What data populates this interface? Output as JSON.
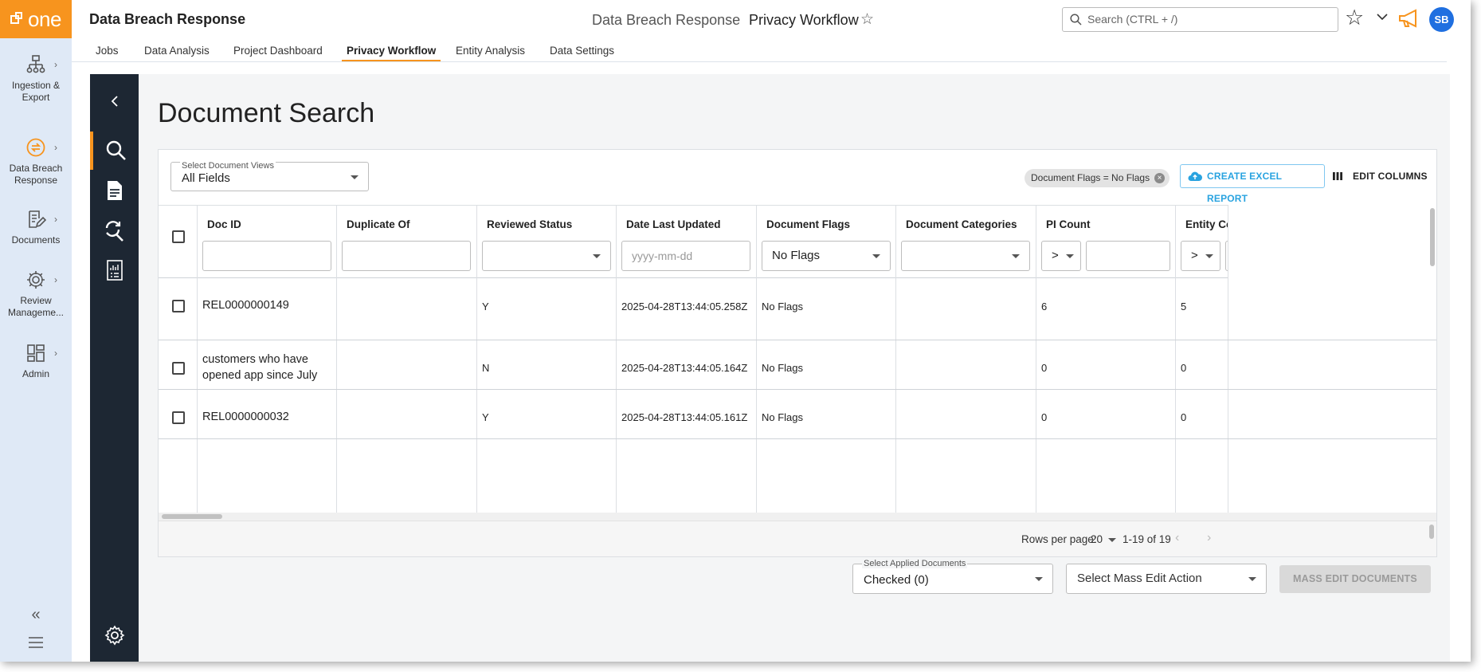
{
  "logo": {
    "text": "one"
  },
  "app_title": "Data Breach Response",
  "breadcrumb": {
    "workspace": "Data Breach Response",
    "current": "Privacy Workflow"
  },
  "search": {
    "placeholder": "Search (CTRL + /)"
  },
  "user": {
    "initials": "SB"
  },
  "accent_color": "#f7941e",
  "tabs": [
    "Jobs",
    "Data Analysis",
    "Project Dashboard",
    "Privacy Workflow",
    "Entity Analysis",
    "Data Settings"
  ],
  "active_tab": "Privacy Workflow",
  "rail": [
    {
      "label": "Ingestion & Export",
      "icon": "hierarchy-icon"
    },
    {
      "label": "Data Breach Response",
      "icon": "sync-circle-icon"
    },
    {
      "label": "Documents",
      "icon": "document-edit-icon"
    },
    {
      "label": "Review Manageme...",
      "icon": "gear-icon"
    },
    {
      "label": "Admin",
      "icon": "dashboard-icon"
    }
  ],
  "page_title": "Document Search",
  "view_select": {
    "label": "Select Document Views",
    "value": "All Fields"
  },
  "filter_chip": "Document Flags = No Flags",
  "buttons": {
    "excel": "CREATE EXCEL REPORT",
    "edit_columns": "EDIT COLUMNS",
    "mass_edit": "MASS EDIT DOCUMENTS"
  },
  "columns": [
    {
      "label": "Doc ID",
      "filter": ""
    },
    {
      "label": "Duplicate Of",
      "filter": ""
    },
    {
      "label": "Reviewed Status",
      "filter": ""
    },
    {
      "label": "Date Last Updated",
      "filter_placeholder": "yyyy-mm-dd"
    },
    {
      "label": "Document Flags",
      "filter": "No Flags"
    },
    {
      "label": "Document Categories",
      "filter": ""
    },
    {
      "label": "PI Count",
      "operator": ">"
    },
    {
      "label": "Entity Cou",
      "operator": ">"
    }
  ],
  "rows": [
    {
      "doc_id": "REL0000000149",
      "duplicate_of": "",
      "reviewed": "Y",
      "date": "2025-04-28T13:44:05.258Z",
      "flags": "No Flags",
      "categories": "",
      "pi_count": "6",
      "entity_count": "5"
    },
    {
      "doc_id_line1": "customers who have",
      "doc_id_line2": "opened app since July",
      "duplicate_of": "",
      "reviewed": "N",
      "date": "2025-04-28T13:44:05.164Z",
      "flags": "No Flags",
      "categories": "",
      "pi_count": "0",
      "entity_count": "0"
    },
    {
      "doc_id": "REL0000000032",
      "duplicate_of": "",
      "reviewed": "Y",
      "date": "2025-04-28T13:44:05.161Z",
      "flags": "No Flags",
      "categories": "",
      "pi_count": "0",
      "entity_count": "0"
    }
  ],
  "pagination": {
    "rows_label": "Rows per page:",
    "rows_value": "20",
    "range": "1-19 of 19"
  },
  "applied_docs": {
    "label": "Select Applied Documents",
    "value": "Checked (0)"
  },
  "mass_edit_select": {
    "placeholder": "Select Mass Edit Action"
  }
}
